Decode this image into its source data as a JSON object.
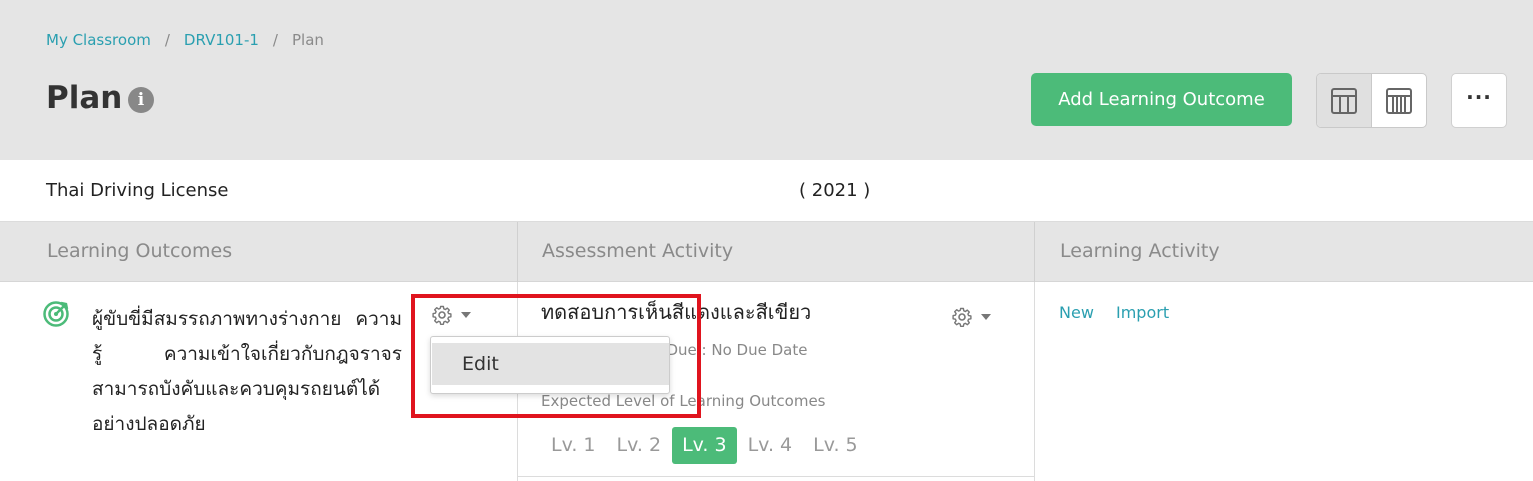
{
  "breadcrumb": {
    "items": [
      "My Classroom",
      "DRV101-1",
      "Plan"
    ],
    "separator": "/"
  },
  "header": {
    "title": "Plan",
    "info_glyph": "i",
    "add_button_label": "Add Learning Outcome",
    "more_label": "···"
  },
  "course": {
    "name": "Thai Driving License",
    "year": "( 2021 )"
  },
  "columns": [
    "Learning Outcomes",
    "Assessment Activity",
    "Learning Activity"
  ],
  "outcome": {
    "text": "ผู้ขับขี่มีสมรรถภาพทางร่างกาย ความรู้ ความเข้าใจเกี่ยวกับกฎจราจร สามารถบังคับและควบคุมรถยนต์ได้อย่างปลอดภัย",
    "icon": "target-icon"
  },
  "dropdown": {
    "items": [
      "Edit"
    ]
  },
  "assessment": {
    "title": "ทดสอบการเห็นสีแดงและสีเขียว",
    "date_text": "n : 21/07/2021 - Due : No Due Date",
    "expected_label": "Expected Level of Learning Outcomes",
    "levels": [
      "Lv. 1",
      "Lv. 2",
      "Lv. 3",
      "Lv. 4",
      "Lv. 5"
    ],
    "active_level": "Lv. 3"
  },
  "learning_activity": {
    "new_label": "New",
    "import_label": "Import"
  },
  "colors": {
    "accent_green": "#4cbb79",
    "link_teal": "#2a9fb0",
    "highlight_red": "#e0141e",
    "header_gray": "#e5e5e5"
  }
}
